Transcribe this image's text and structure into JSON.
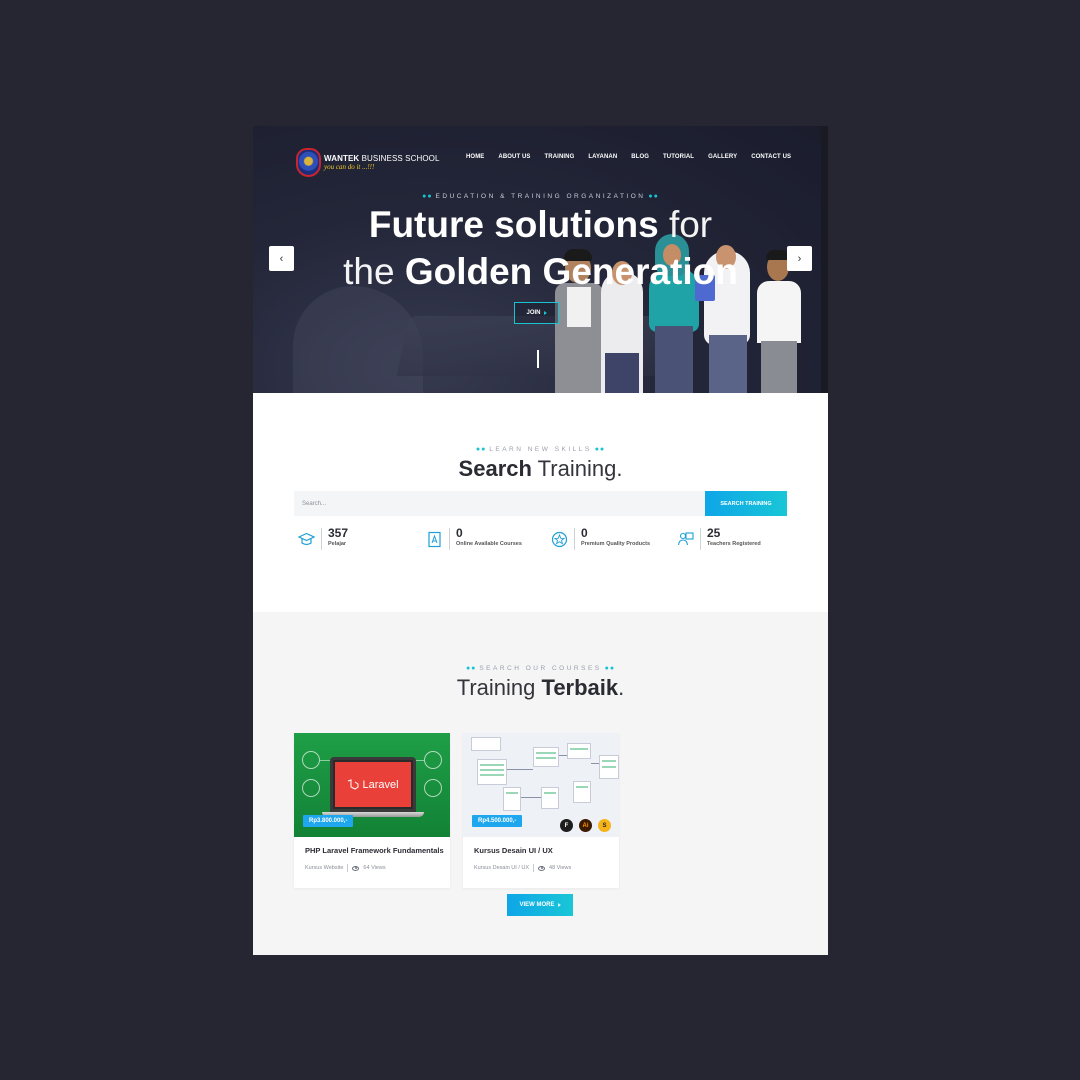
{
  "brand": {
    "name_bold": "WANTEK",
    "name_rest": " BUSINESS SCHOOL",
    "tagline": "you can do it ...!!!"
  },
  "nav": [
    "HOME",
    "ABOUT US",
    "TRAINING",
    "LAYANAN",
    "BLOG",
    "TUTORIAL",
    "GALLERY",
    "CONTACT US"
  ],
  "hero": {
    "eyebrow": "EDUCATION & TRAINING ORGANIZATION",
    "line1_bold": "Future solutions",
    "line1_thin": " for",
    "line2_thin": "the ",
    "line2_bold": "Golden Generation",
    "join_label": "JOIN",
    "prev_icon": "‹",
    "next_icon": "›"
  },
  "search_section": {
    "eyebrow": "LEARN NEW SKILLS",
    "title_bold": "Search",
    "title_thin": " Training.",
    "placeholder": "Search...",
    "button": "SEARCH TRAINING"
  },
  "stats": [
    {
      "value": "357",
      "label": "Pelajar",
      "icon": "graduation-cap-icon"
    },
    {
      "value": "0",
      "label": "Online Available Courses",
      "icon": "book-icon"
    },
    {
      "value": "0",
      "label": "Premium Quality Products",
      "icon": "star-badge-icon"
    },
    {
      "value": "25",
      "label": "Teachers Registered",
      "icon": "teacher-icon"
    }
  ],
  "courses_section": {
    "eyebrow": "SEARCH OUR COURSES",
    "title_thin": "Training ",
    "title_bold": "Terbaik",
    "title_dot": ".",
    "view_more": "VIEW MORE"
  },
  "courses": [
    {
      "price": "Rp3.800.000,-",
      "title": "PHP Laravel Framework Fundamentals",
      "category": "Kursus Website",
      "views": "64 Views",
      "image_text": "Laravel"
    },
    {
      "price": "Rp4.500.000,-",
      "title": "Kursus Desain UI / UX",
      "category": "Kursus Desain UI / UX",
      "views": "48 Views",
      "tool_labels": [
        "F",
        "Ai",
        "S"
      ]
    }
  ],
  "colors": {
    "accent": "#19c4d2",
    "button_blue": "#0ea6e8",
    "price_blue": "#1ea6ee",
    "page_bg": "#262632"
  }
}
